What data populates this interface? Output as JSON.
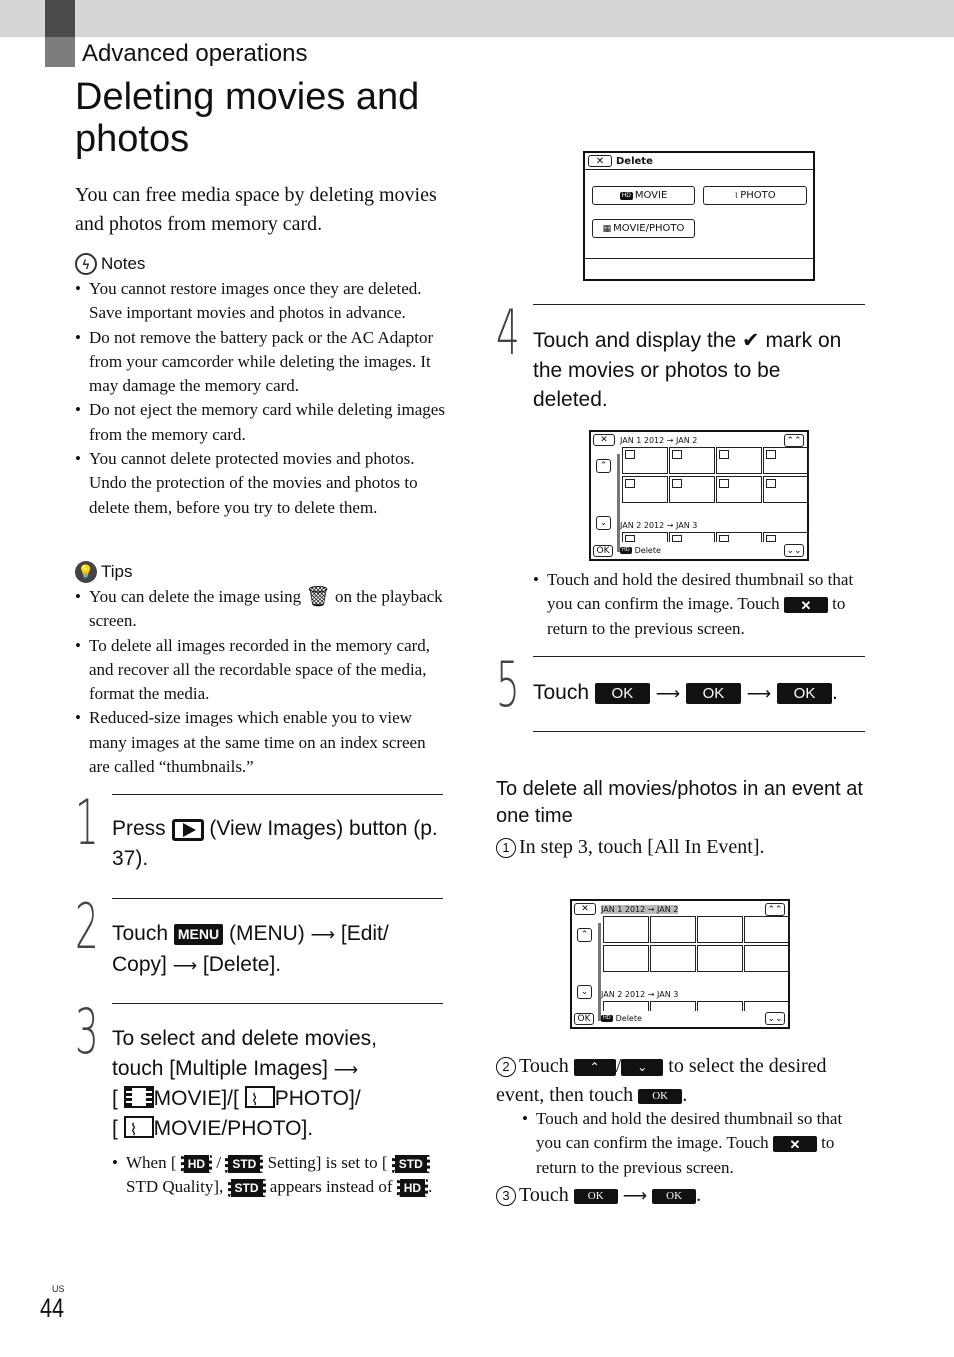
{
  "header": {
    "section": "Advanced operations",
    "title_line1": "Deleting movies and",
    "title_line2": "photos"
  },
  "intro": "You can free media space by deleting movies and photos from memory card.",
  "notes": {
    "icon": "notes-icon",
    "heading": "Notes",
    "items": [
      "You cannot restore images once they are deleted. Save important movies and photos in advance.",
      "Do not remove the battery pack or the AC Adaptor from your camcorder while deleting the images. It may damage the memory card.",
      "Do not eject the memory card while deleting images from the memory card.",
      "You cannot delete protected movies and photos. Undo the protection of the movies and photos to delete them, before you try to delete them."
    ]
  },
  "tips": {
    "icon": "tips-icon",
    "heading": "Tips",
    "item1_pre": "You can delete the image using",
    "item1_post": "on the playback screen.",
    "item2": "To delete all images recorded in the memory card, and recover all the recordable space of the media, format the media.",
    "item3": "Reduced-size images which enable you to view many images at the same time on an index screen are called “thumbnails.”"
  },
  "steps": [
    {
      "num": "1",
      "pre": "Press",
      "post": "(View Images) button (p. 37)."
    },
    {
      "num": "2",
      "pre": "Touch",
      "menu_key": "MENU",
      "post1": "(MENU)",
      "post2": "[Edit/ Copy]",
      "post3": "[Delete]."
    },
    {
      "num": "3",
      "line1": "To select and delete movies,",
      "line2": "touch [Multiple Images]",
      "movie": "MOVIE]/[",
      "photo": "PHOTO]/",
      "moviephoto": "MOVIE/PHOTO].",
      "note_pre": "When [",
      "note_hd": "HD",
      "note_std": "STD",
      "note_mid": "Setting] is set to [",
      "note_mid2": "STD Quality],",
      "note_mid3": "appears instead of",
      "note_end": "."
    },
    {
      "num": "4",
      "pre": "Touch and display the",
      "check": "✔",
      "post": "mark on the movies or photos to be deleted.",
      "bullet_pre": "Touch and hold the desired thumbnail so that you can confirm the image. Touch",
      "bullet_post": "to return to the previous screen."
    },
    {
      "num": "5",
      "pre": "Touch",
      "ok": "OK",
      "end": "."
    }
  ],
  "keys": {
    "close": "✕",
    "ok": "OK",
    "up": "⌃",
    "down": "⌄",
    "arrow": "⟶"
  },
  "screen_delete": {
    "title": "Delete",
    "close": "✕",
    "buttons": [
      {
        "badge": "HD",
        "label": "MOVIE"
      },
      {
        "badge": "⌇",
        "label": "PHOTO"
      },
      {
        "badge": "▦",
        "label": "MOVIE/PHOTO"
      }
    ]
  },
  "screen_index": {
    "close": "✕",
    "event1": "JAN 1 2012  →  JAN 2",
    "event2": "JAN 2 2012  →  JAN 3",
    "ok": "OK",
    "footer_badge": "HD",
    "footer": "Delete",
    "page_up": "⌃⌃",
    "page_down": "⌄⌄"
  },
  "event_section": {
    "heading": "To delete all movies/photos in an event at one time",
    "s1_num": "1",
    "s1": "In step 3, touch [All In Event].",
    "s2_num": "2",
    "s2_pre": "Touch",
    "s2_mid": "to select the desired event, then touch",
    "s2_bullet_pre": "Touch and hold the desired thumbnail so that you can confirm the image. Touch",
    "s2_bullet_post": "to return to the previous screen.",
    "s3_num": "3",
    "s3_pre": "Touch"
  },
  "footer": {
    "region": "US",
    "page": "44"
  }
}
